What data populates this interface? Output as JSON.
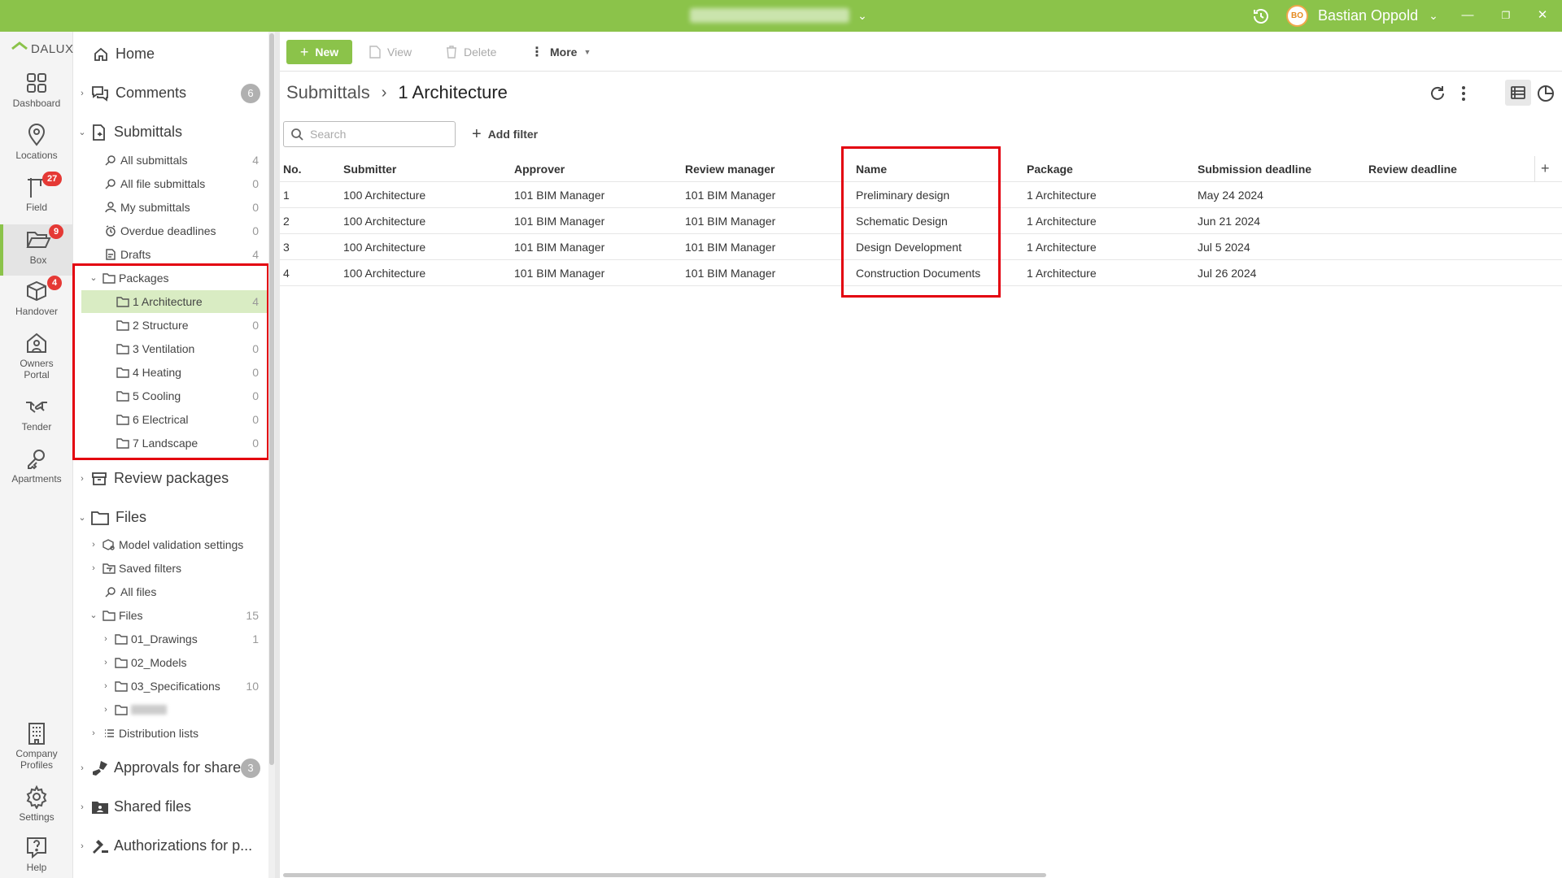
{
  "titlebar": {
    "user_initials": "BO",
    "user_name": "Bastian Oppold",
    "win_min": "—",
    "win_max": "❐",
    "win_close": "✕"
  },
  "rail": {
    "logo": "DALUX",
    "items": [
      {
        "label": "Dashboard",
        "icon": "dashboard-icon"
      },
      {
        "label": "Locations",
        "icon": "location-pin-icon"
      },
      {
        "label": "Field",
        "icon": "crane-icon",
        "badge": "27"
      },
      {
        "label": "Box",
        "icon": "folder-open-icon",
        "badge": "9"
      },
      {
        "label": "Handover",
        "icon": "box-icon",
        "badge": "4"
      },
      {
        "label": "Owners",
        "label2": "Portal",
        "icon": "house-person-icon"
      },
      {
        "label": "Tender",
        "icon": "handshake-icon"
      },
      {
        "label": "Apartments",
        "icon": "key-icon"
      },
      {
        "label": "Company",
        "label2": "Profiles",
        "icon": "building-icon"
      },
      {
        "label": "Settings",
        "icon": "gear-icon"
      },
      {
        "label": "Help",
        "icon": "help-icon"
      }
    ]
  },
  "tree": {
    "home": "Home",
    "comments": {
      "label": "Comments",
      "count": "6"
    },
    "submittals": {
      "label": "Submittals"
    },
    "sub_items": [
      {
        "label": "All submittals",
        "count": "4"
      },
      {
        "label": "All file submittals",
        "count": "0"
      },
      {
        "label": "My submittals",
        "count": "0"
      },
      {
        "label": "Overdue deadlines",
        "count": "0"
      },
      {
        "label": "Drafts",
        "count": "4"
      }
    ],
    "packages": {
      "label": "Packages",
      "items": [
        {
          "label": "1 Architecture",
          "count": "4"
        },
        {
          "label": "2 Structure",
          "count": "0"
        },
        {
          "label": "3 Ventilation",
          "count": "0"
        },
        {
          "label": "4 Heating",
          "count": "0"
        },
        {
          "label": "5 Cooling",
          "count": "0"
        },
        {
          "label": "6 Electrical",
          "count": "0"
        },
        {
          "label": "7 Landscape",
          "count": "0"
        }
      ]
    },
    "review_packages": "Review packages",
    "files_section": "Files",
    "model_validation": "Model validation settings",
    "saved_filters": "Saved filters",
    "all_files": "All files",
    "files_folder": {
      "label": "Files",
      "count": "15"
    },
    "file_folders": [
      {
        "label": "01_Drawings",
        "count": "1"
      },
      {
        "label": "02_Models",
        "count": ""
      },
      {
        "label": "03_Specifications",
        "count": "10"
      }
    ],
    "distribution_lists": "Distribution lists",
    "approvals": {
      "label": "Approvals for share...",
      "count": "3"
    },
    "shared_files": "Shared files",
    "authorizations": "Authorizations for p..."
  },
  "toolbar": {
    "new": "New",
    "view": "View",
    "delete": "Delete",
    "more": "More"
  },
  "breadcrumb": {
    "root": "Submittals",
    "current": "1 Architecture"
  },
  "search": {
    "placeholder": "Search"
  },
  "add_filter": "Add filter",
  "table": {
    "headers": [
      "No.",
      "Submitter",
      "Approver",
      "Review manager",
      "Name",
      "Package",
      "Submission deadline",
      "Review deadline"
    ],
    "rows": [
      [
        "1",
        "100 Architecture",
        "101 BIM Manager",
        "101 BIM Manager",
        "Preliminary design",
        "1 Architecture",
        "May 24 2024",
        ""
      ],
      [
        "2",
        "100 Architecture",
        "101 BIM Manager",
        "101 BIM Manager",
        "Schematic Design",
        "1 Architecture",
        "Jun 21 2024",
        ""
      ],
      [
        "3",
        "100 Architecture",
        "101 BIM Manager",
        "101 BIM Manager",
        "Design Development",
        "1 Architecture",
        "Jul 5 2024",
        ""
      ],
      [
        "4",
        "100 Architecture",
        "101 BIM Manager",
        "101 BIM Manager",
        "Construction Documents",
        "1 Architecture",
        "Jul 26 2024",
        ""
      ]
    ]
  },
  "colors": {
    "accent": "#8bc34a",
    "selected": "#d9ecc3",
    "highlight": "#e3000f",
    "badge": "#e53935"
  }
}
